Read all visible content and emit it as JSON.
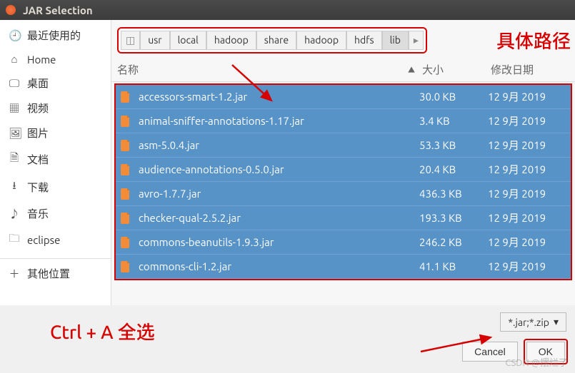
{
  "title": "JAR Selection",
  "sidebar": {
    "items": [
      {
        "icon": "🕘",
        "label": "最近使用的"
      },
      {
        "icon": "⌂",
        "label": "Home"
      },
      {
        "icon": "🖵",
        "label": "桌面"
      },
      {
        "icon": "▦",
        "label": "视频"
      },
      {
        "icon": "🖼",
        "label": "图片"
      },
      {
        "icon": "🗎",
        "label": "文档"
      },
      {
        "icon": "⭳",
        "label": "下载"
      },
      {
        "icon": "♪",
        "label": "音乐"
      },
      {
        "icon": "🗀",
        "label": "eclipse"
      },
      {
        "icon": "＋",
        "label": "其他位置"
      }
    ]
  },
  "breadcrumb": [
    "usr",
    "local",
    "hadoop",
    "share",
    "hadoop",
    "hdfs",
    "lib"
  ],
  "breadcrumb_active_index": 6,
  "columns": {
    "name": "名称",
    "size": "大小",
    "date": "修改日期"
  },
  "files": [
    {
      "name": "accessors-smart-1.2.jar",
      "size": "30.0 KB",
      "date": "12 9月 2019"
    },
    {
      "name": "animal-sniffer-annotations-1.17.jar",
      "size": "3.4 KB",
      "date": "12 9月 2019"
    },
    {
      "name": "asm-5.0.4.jar",
      "size": "53.3 KB",
      "date": "12 9月 2019"
    },
    {
      "name": "audience-annotations-0.5.0.jar",
      "size": "20.4 KB",
      "date": "12 9月 2019"
    },
    {
      "name": "avro-1.7.7.jar",
      "size": "436.3 KB",
      "date": "12 9月 2019"
    },
    {
      "name": "checker-qual-2.5.2.jar",
      "size": "193.3 KB",
      "date": "12 9月 2019"
    },
    {
      "name": "commons-beanutils-1.9.3.jar",
      "size": "246.2 KB",
      "date": "12 9月 2019"
    },
    {
      "name": "commons-cli-1.2.jar",
      "size": "41.1 KB",
      "date": "12 9月 2019"
    }
  ],
  "filter": "*.jar;*.zip",
  "buttons": {
    "cancel": "Cancel",
    "ok": "OK"
  },
  "annotations": {
    "path": "具体路径",
    "selectall": "Ctrl + A 全选"
  },
  "watermark": "CSDN @摆烂了"
}
